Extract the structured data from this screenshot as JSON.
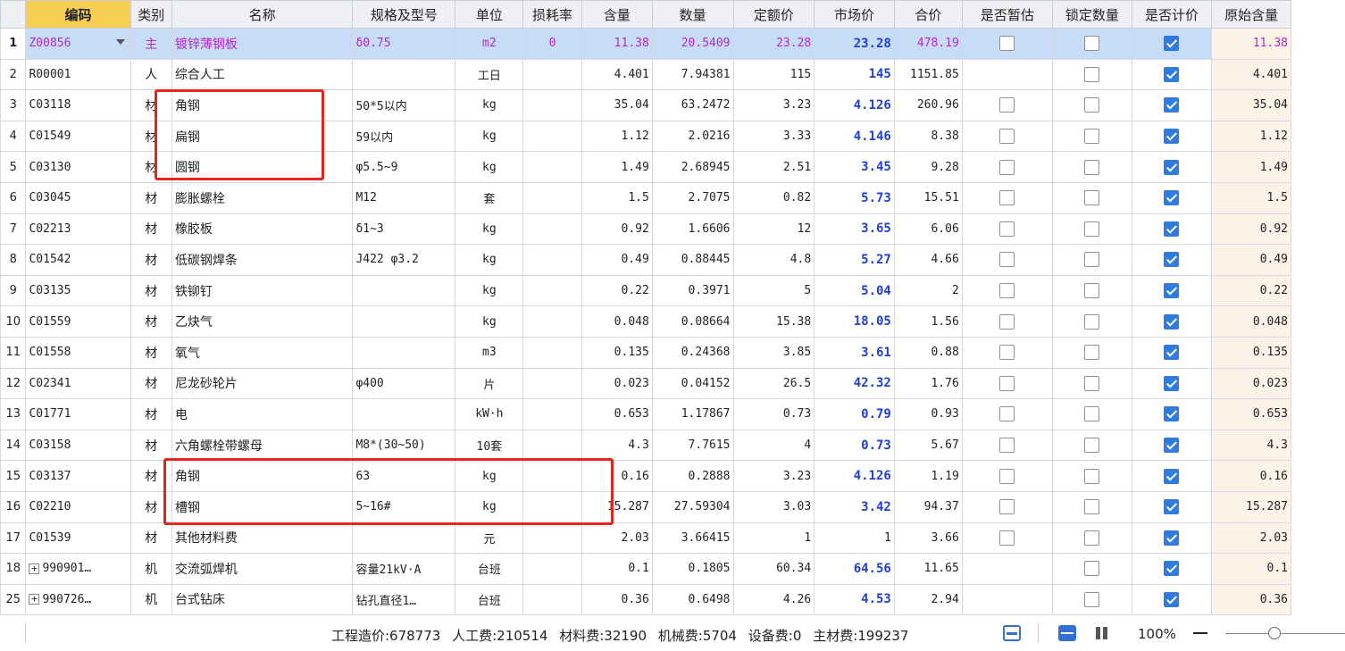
{
  "columns": [
    "编码",
    "类别",
    "名称",
    "规格及型号",
    "单位",
    "损耗率",
    "含量",
    "数量",
    "定额价",
    "市场价",
    "合价",
    "是否暂估",
    "锁定数量",
    "是否计价",
    "原始含量"
  ],
  "rows": [
    {
      "no": "1",
      "code": "Z00856",
      "type": "主",
      "name": "镀锌薄钢板",
      "spec": "δ0.75",
      "unit": "m2",
      "loss": "0",
      "content": "11.38",
      "qty": "20.5409",
      "quota": "23.28",
      "market": "23.28",
      "total": "478.19",
      "est": false,
      "lock": false,
      "priced": true,
      "orig": "11.38"
    },
    {
      "no": "2",
      "code": "R00001",
      "type": "人",
      "name": "综合人工",
      "spec": "",
      "unit": "工日",
      "loss": "",
      "content": "4.401",
      "qty": "7.94381",
      "quota": "115",
      "market": "145",
      "total": "1151.85",
      "est": null,
      "lock": false,
      "priced": true,
      "orig": "4.401"
    },
    {
      "no": "3",
      "code": "C03118",
      "type": "材",
      "name": "角钢",
      "spec": "50*5以内",
      "unit": "kg",
      "loss": "",
      "content": "35.04",
      "qty": "63.2472",
      "quota": "3.23",
      "market": "4.126",
      "total": "260.96",
      "est": false,
      "lock": false,
      "priced": true,
      "orig": "35.04"
    },
    {
      "no": "4",
      "code": "C01549",
      "type": "材",
      "name": "扁钢",
      "spec": "59以内",
      "unit": "kg",
      "loss": "",
      "content": "1.12",
      "qty": "2.0216",
      "quota": "3.33",
      "market": "4.146",
      "total": "8.38",
      "est": false,
      "lock": false,
      "priced": true,
      "orig": "1.12"
    },
    {
      "no": "5",
      "code": "C03130",
      "type": "材",
      "name": "圆钢",
      "spec": "φ5.5~9",
      "unit": "kg",
      "loss": "",
      "content": "1.49",
      "qty": "2.68945",
      "quota": "2.51",
      "market": "3.45",
      "total": "9.28",
      "est": false,
      "lock": false,
      "priced": true,
      "orig": "1.49"
    },
    {
      "no": "6",
      "code": "C03045",
      "type": "材",
      "name": "膨胀螺栓",
      "spec": "M12",
      "unit": "套",
      "loss": "",
      "content": "1.5",
      "qty": "2.7075",
      "quota": "0.82",
      "market": "5.73",
      "total": "15.51",
      "est": false,
      "lock": false,
      "priced": true,
      "orig": "1.5"
    },
    {
      "no": "7",
      "code": "C02213",
      "type": "材",
      "name": "橡胶板",
      "spec": "δ1~3",
      "unit": "kg",
      "loss": "",
      "content": "0.92",
      "qty": "1.6606",
      "quota": "12",
      "market": "3.65",
      "total": "6.06",
      "est": false,
      "lock": false,
      "priced": true,
      "orig": "0.92"
    },
    {
      "no": "8",
      "code": "C01542",
      "type": "材",
      "name": "低碳钢焊条",
      "spec": "J422 φ3.2",
      "unit": "kg",
      "loss": "",
      "content": "0.49",
      "qty": "0.88445",
      "quota": "4.8",
      "market": "5.27",
      "total": "4.66",
      "est": false,
      "lock": false,
      "priced": true,
      "orig": "0.49"
    },
    {
      "no": "9",
      "code": "C03135",
      "type": "材",
      "name": "铁铆钉",
      "spec": "",
      "unit": "kg",
      "loss": "",
      "content": "0.22",
      "qty": "0.3971",
      "quota": "5",
      "market": "5.04",
      "total": "2",
      "est": false,
      "lock": false,
      "priced": true,
      "orig": "0.22"
    },
    {
      "no": "10",
      "code": "C01559",
      "type": "材",
      "name": "乙炔气",
      "spec": "",
      "unit": "kg",
      "loss": "",
      "content": "0.048",
      "qty": "0.08664",
      "quota": "15.38",
      "market": "18.05",
      "total": "1.56",
      "est": false,
      "lock": false,
      "priced": true,
      "orig": "0.048"
    },
    {
      "no": "11",
      "code": "C01558",
      "type": "材",
      "name": "氧气",
      "spec": "",
      "unit": "m3",
      "loss": "",
      "content": "0.135",
      "qty": "0.24368",
      "quota": "3.85",
      "market": "3.61",
      "total": "0.88",
      "est": false,
      "lock": false,
      "priced": true,
      "orig": "0.135"
    },
    {
      "no": "12",
      "code": "C02341",
      "type": "材",
      "name": "尼龙砂轮片",
      "spec": "φ400",
      "unit": "片",
      "loss": "",
      "content": "0.023",
      "qty": "0.04152",
      "quota": "26.5",
      "market": "42.32",
      "total": "1.76",
      "est": false,
      "lock": false,
      "priced": true,
      "orig": "0.023"
    },
    {
      "no": "13",
      "code": "C01771",
      "type": "材",
      "name": "电",
      "spec": "",
      "unit": "kW·h",
      "loss": "",
      "content": "0.653",
      "qty": "1.17867",
      "quota": "0.73",
      "market": "0.79",
      "total": "0.93",
      "est": false,
      "lock": false,
      "priced": true,
      "orig": "0.653"
    },
    {
      "no": "14",
      "code": "C03158",
      "type": "材",
      "name": "六角螺栓带螺母",
      "spec": "M8*(30~50)",
      "unit": "10套",
      "loss": "",
      "content": "4.3",
      "qty": "7.7615",
      "quota": "4",
      "market": "0.73",
      "total": "5.67",
      "est": false,
      "lock": false,
      "priced": true,
      "orig": "4.3"
    },
    {
      "no": "15",
      "code": "C03137",
      "type": "材",
      "name": "角钢",
      "spec": "63",
      "unit": "kg",
      "loss": "",
      "content": "0.16",
      "qty": "0.2888",
      "quota": "3.23",
      "market": "4.126",
      "total": "1.19",
      "est": false,
      "lock": false,
      "priced": true,
      "orig": "0.16"
    },
    {
      "no": "16",
      "code": "C02210",
      "type": "材",
      "name": "槽钢",
      "spec": "5~16#",
      "unit": "kg",
      "loss": "",
      "content": "15.287",
      "qty": "27.59304",
      "quota": "3.03",
      "market": "3.42",
      "total": "94.37",
      "est": false,
      "lock": false,
      "priced": true,
      "orig": "15.287"
    },
    {
      "no": "17",
      "code": "C01539",
      "type": "材",
      "name": "其他材料费",
      "spec": "",
      "unit": "元",
      "loss": "",
      "content": "2.03",
      "qty": "3.66415",
      "quota": "1",
      "market": "1",
      "total": "3.66",
      "est": false,
      "lock": false,
      "priced": true,
      "orig": "2.03",
      "plainMarket": true
    },
    {
      "no": "18",
      "code": "990901…",
      "expand": "+",
      "type": "机",
      "name": "交流弧焊机",
      "spec": "容量21kV·A",
      "unit": "台班",
      "loss": "",
      "content": "0.1",
      "qty": "0.1805",
      "quota": "60.34",
      "market": "64.56",
      "total": "11.65",
      "est": null,
      "lock": false,
      "priced": true,
      "orig": "0.1"
    },
    {
      "no": "25",
      "code": "990726…",
      "expand": "+",
      "type": "机",
      "name": "台式钻床",
      "spec": "钻孔直径1…",
      "unit": "台班",
      "loss": "",
      "content": "0.36",
      "qty": "0.6498",
      "quota": "4.26",
      "market": "4.53",
      "total": "2.94",
      "est": null,
      "lock": false,
      "priced": true,
      "orig": "0.36"
    }
  ],
  "status": {
    "project_cost": "工程造价:678773",
    "labor": "人工费:210514",
    "material": "材料费:32190",
    "machine": "机械费:5704",
    "equipment": "设备费:0",
    "main_material": "主材费:199237",
    "zoom": "100%"
  },
  "colors": {
    "market_price": "#1f3fd8",
    "main_row_text": "#b528c8",
    "selected_row": "#c7dcf7",
    "highlight_box": "#e8231c",
    "checkbox_on": "#2f7be0"
  }
}
